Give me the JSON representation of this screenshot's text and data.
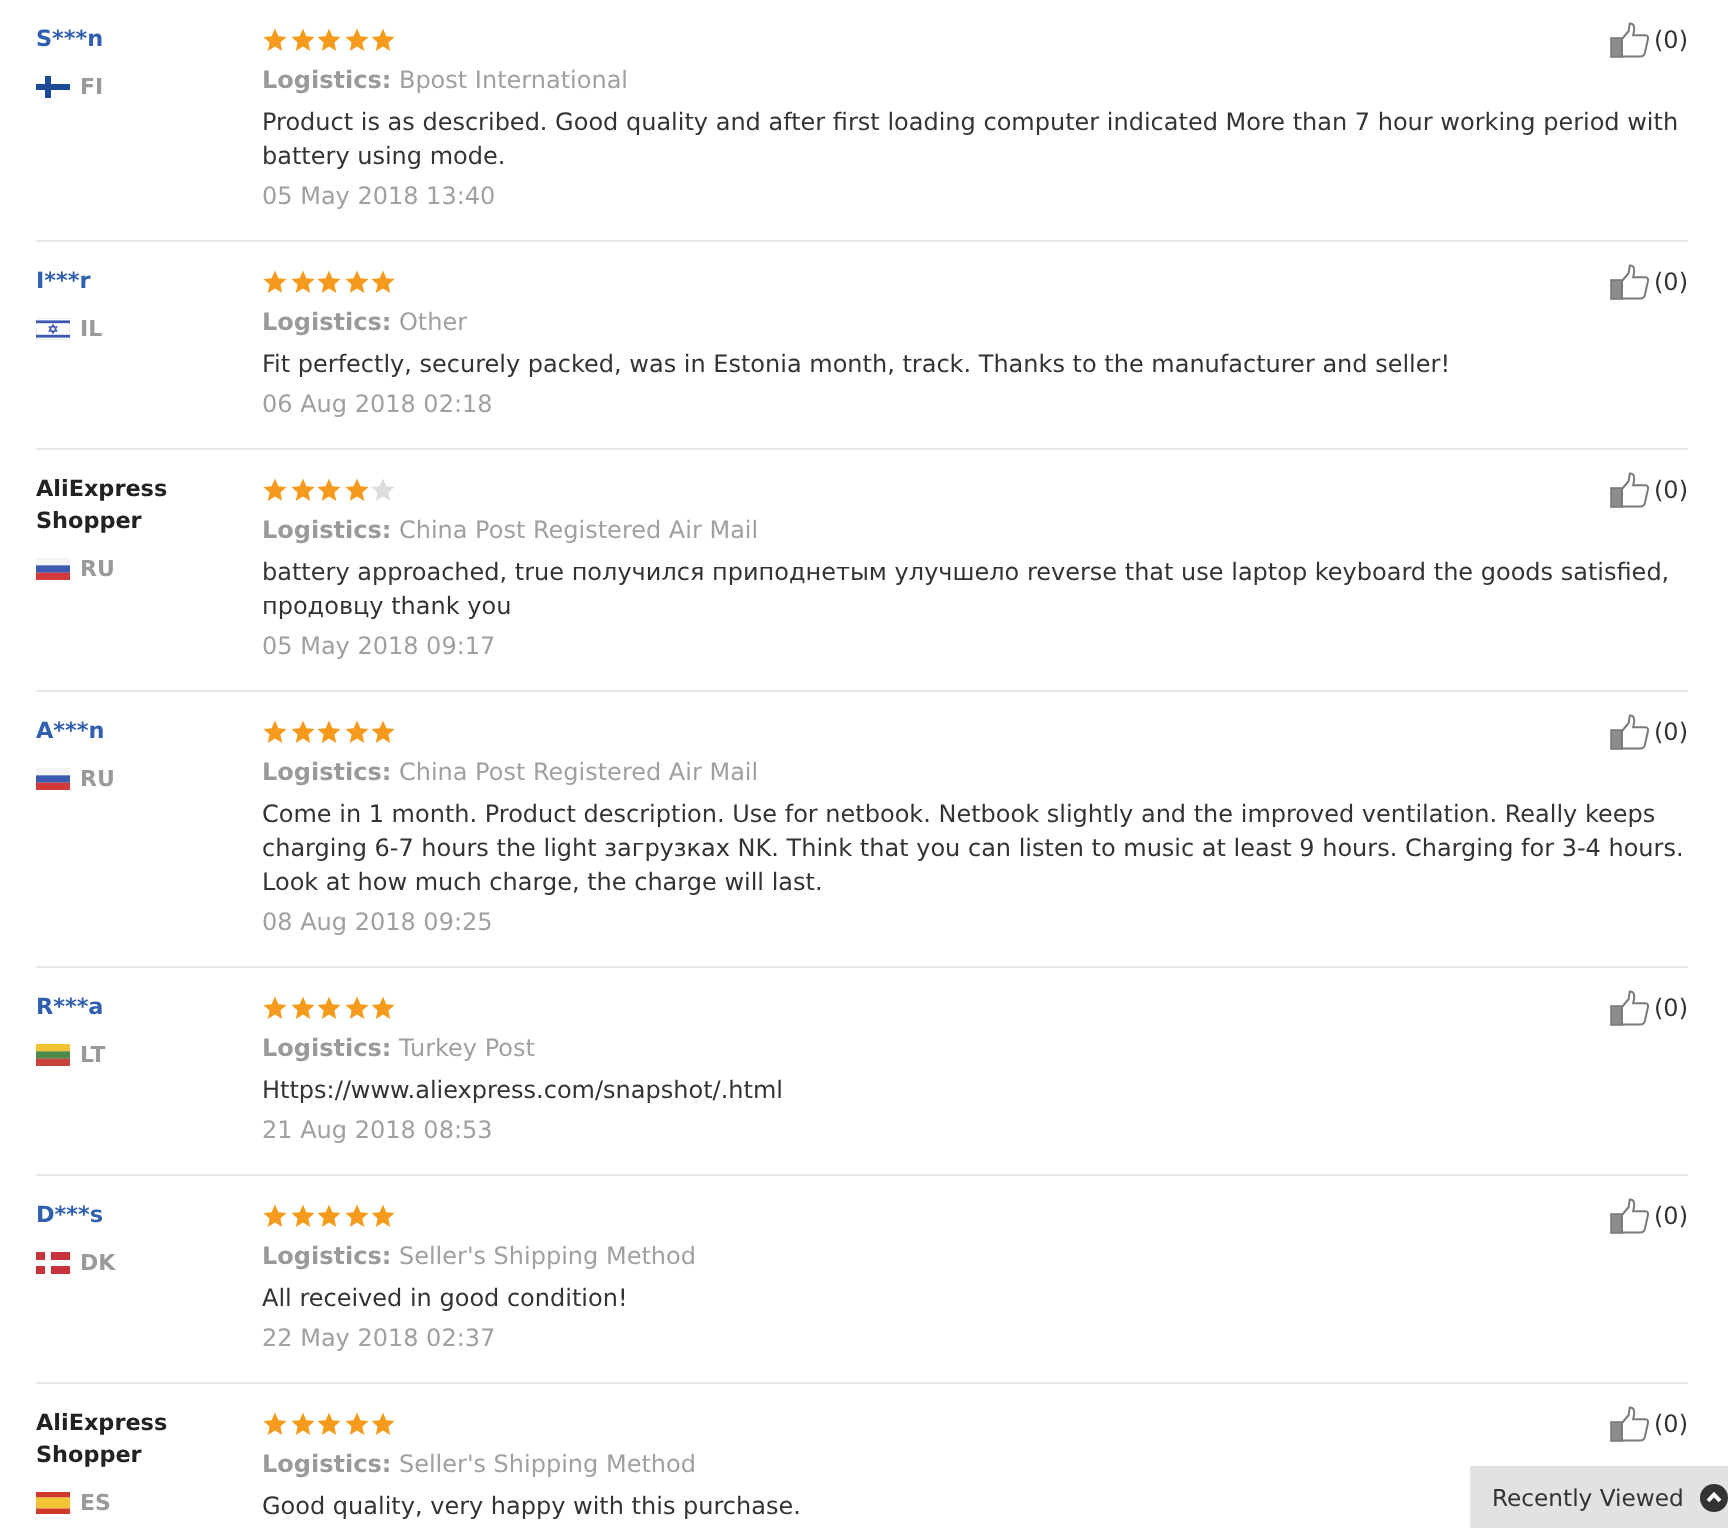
{
  "reviews": [
    {
      "reviewer": "S***n",
      "linked": true,
      "flag": {
        "kind": "finland"
      },
      "country": "FI",
      "stars": 5,
      "logistics": "**Logistics:** Bpost International",
      "text": "Product is as described. Good quality and after first loading computer indicated More than 7 hour working period with battery using mode.",
      "date": "05 May 2018 13:40",
      "likes": "(0)"
    },
    {
      "reviewer": "I***r",
      "linked": true,
      "flag": {
        "kind": "israel"
      },
      "country": "IL",
      "stars": 5,
      "logistics": "**Logistics:** Other",
      "text": "Fit perfectly, securely packed, was in Estonia month, track. Thanks to the manufacturer and seller!",
      "date": "06 Aug 2018 02:18",
      "likes": "(0)"
    },
    {
      "reviewer": "AliExpress Shopper",
      "linked": false,
      "flag": {
        "kind": "russia"
      },
      "country": "RU",
      "stars": 4,
      "logistics": "**Logistics:** China Post Registered Air Mail",
      "text": "battery approached, true получился приподнетым улучшело reverse that use laptop keyboard the goods satisfied, продовцу thank you",
      "date": "05 May 2018 09:17",
      "likes": "(0)"
    },
    {
      "reviewer": "A***n",
      "linked": true,
      "flag": {
        "kind": "russia"
      },
      "country": "RU",
      "stars": 5,
      "logistics": "**Logistics:** China Post Registered Air Mail",
      "text": "Come in 1 month. Product description. Use for netbook. Netbook slightly and the improved ventilation. Really keeps charging 6-7 hours the light загрузках NK. Think that you can listen to music at least 9 hours. Charging for 3-4 hours. Look at how much charge, the charge will last.",
      "date": "08 Aug 2018 09:25",
      "likes": "(0)"
    },
    {
      "reviewer": "R***a",
      "linked": true,
      "flag": {
        "kind": "lithuania"
      },
      "country": "LT",
      "stars": 5,
      "logistics": "**Logistics:** Turkey Post",
      "text": "Https://www.aliexpress.com/snapshot/.html",
      "date": "21 Aug 2018 08:53",
      "likes": "(0)"
    },
    {
      "reviewer": "D***s",
      "linked": true,
      "flag": {
        "kind": "denmark"
      },
      "country": "DK",
      "stars": 5,
      "logistics": "**Logistics:** Seller's Shipping Method",
      "text": "All received in good condition!",
      "date": "22 May 2018 02:37",
      "likes": "(0)"
    },
    {
      "reviewer": "AliExpress Shopper",
      "linked": false,
      "flag": {
        "kind": "spain"
      },
      "country": "ES",
      "stars": 5,
      "logistics": "**Logistics:** Seller's Shipping Method",
      "text": "Good quality, very happy with this purchase.",
      "likes": "(0)"
    }
  ],
  "recently_viewed": {
    "label": "Recently Viewed"
  }
}
